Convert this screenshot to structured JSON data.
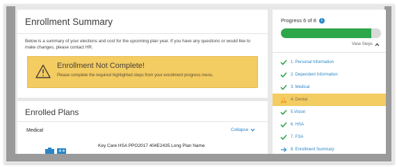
{
  "summary": {
    "title": "Enrollment Summary",
    "text": "Below is a summary of your elections and cost for the upcoming plan year. If you have any questions or would like to make changes, please contact HR.",
    "alert": {
      "title": "Enrollment Not Complete!",
      "message": "Please complete the required highlighted steps from your enrollment progress menu."
    }
  },
  "plans": {
    "title": "Enrolled Plans",
    "section": "Medical",
    "collapse_label": "Collapse",
    "plan_name": "Key Care HSA PPO2017 404E2435 Long Plan Name"
  },
  "progress": {
    "title": "Progress 6 of 8",
    "fraction": 0.9,
    "view_steps_label": "View Steps",
    "steps": [
      {
        "label": "1. Personal Information",
        "status": "done"
      },
      {
        "label": "2. Dependent Information",
        "status": "done"
      },
      {
        "label": "3. Medical",
        "status": "done"
      },
      {
        "label": "4. Dental",
        "status": "warning"
      },
      {
        "label": "5.Vision",
        "status": "done"
      },
      {
        "label": "6. HSA",
        "status": "done"
      },
      {
        "label": "7. FSA",
        "status": "done"
      },
      {
        "label": "8. Enrollment Summary",
        "status": "arrow"
      }
    ]
  },
  "colors": {
    "accent": "#2a86c6",
    "success": "#2ea64a",
    "warning": "#f3cc62"
  }
}
